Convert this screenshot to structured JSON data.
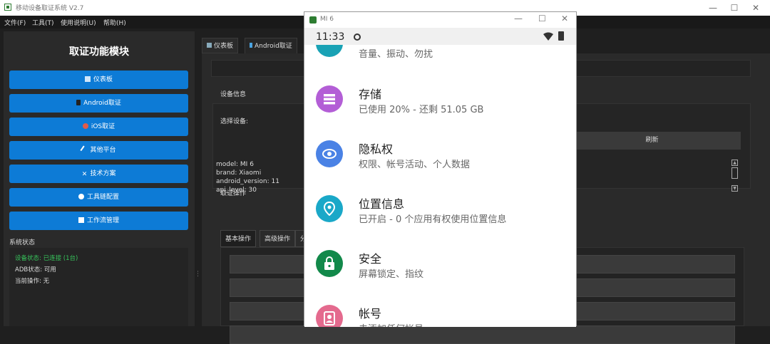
{
  "window": {
    "title": "移动设备取证系统 V2.7"
  },
  "menu": [
    "文件(F)",
    "工具(T)",
    "使用说明(U)",
    "帮助(H)"
  ],
  "sidebar": {
    "title": "取证功能模块",
    "buttons": [
      "仪表板",
      "Android取证",
      "iOS取证",
      "其他平台",
      "技术方案",
      "工具链配置",
      "工作流管理"
    ],
    "status_title": "系统状态",
    "status_lines": [
      "设备状态: 已连接 (1台)",
      "ADB状态: 可用",
      "当前操作: 无"
    ]
  },
  "tabs": [
    "仪表板",
    "Android取证"
  ],
  "panel": {
    "device_info_label": "设备信息",
    "select_device_label": "选择设备:",
    "refresh_label": "刷新",
    "device_lines": [
      "model: MI 6",
      "brand: Xiaomi",
      "android_version: 11",
      "api_level: 30"
    ],
    "forensic_ops_label": "取证操作",
    "subtabs": [
      "基本操作",
      "高级操作",
      "分"
    ]
  },
  "phone": {
    "window_title": "MI 6",
    "time": "11:33",
    "settings": [
      {
        "title": "",
        "subtitle": "音量、振动、勿扰",
        "color": "#19a2b5",
        "icon": "sound-icon"
      },
      {
        "title": "存储",
        "subtitle": "已使用 20% - 还剩 51.05 GB",
        "color": "#b35ed6",
        "icon": "storage-icon"
      },
      {
        "title": "隐私权",
        "subtitle": "权限、帐号活动、个人数据",
        "color": "#4a82e5",
        "icon": "privacy-icon"
      },
      {
        "title": "位置信息",
        "subtitle": "已开启 - 0 个应用有权使用位置信息",
        "color": "#1aa8c8",
        "icon": "location-icon"
      },
      {
        "title": "安全",
        "subtitle": "屏幕锁定、指纹",
        "color": "#12894a",
        "icon": "lock-icon"
      },
      {
        "title": "帐号",
        "subtitle": "未添加任何帐号",
        "color": "#e46a8e",
        "icon": "account-icon"
      }
    ]
  }
}
